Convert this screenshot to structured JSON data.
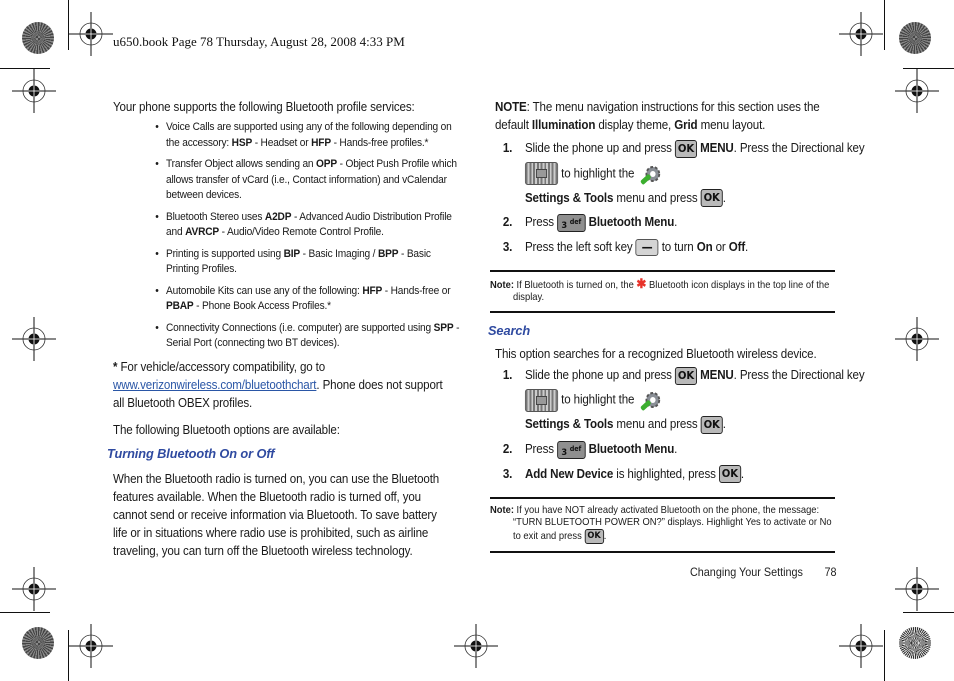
{
  "slug": "u650.book  Page 78  Thursday, August 28, 2008  4:33 PM",
  "left": {
    "intro": "Your phone supports the following Bluetooth profile services:",
    "bullets": [
      {
        "a": "Voice Calls are supported using any of the following depending on the accessory: ",
        "b1": "HSP",
        "c": " - Headset or ",
        "b2": "HFP",
        "d": " - Hands-free profiles.*"
      },
      {
        "a": "Transfer Object allows sending an ",
        "b1": "OPP",
        "c": " - Object Push Profile which allows transfer of vCard (i.e., Contact information) and vCalendar between devices.",
        "b2": "",
        "d": ""
      },
      {
        "a": "Bluetooth Stereo uses ",
        "b1": "A2DP",
        "c": " - Advanced Audio Distribution Profile and ",
        "b2": "AVRCP",
        "d": " - Audio/Video Remote Control Profile."
      },
      {
        "a": "Printing is supported using ",
        "b1": "BIP",
        "c": " - Basic Imaging / ",
        "b2": "BPP",
        "d": " - Basic Printing Profiles."
      },
      {
        "a": "Automobile Kits can use any of the following: ",
        "b1": "HFP",
        "c": " - Hands-free or ",
        "b2": "PBAP",
        "d": " - Phone Book Access Profiles.*"
      },
      {
        "a": "Connectivity Connections (i.e. computer) are supported using ",
        "b1": "SPP",
        "c": " - Serial Port (connecting two BT devices).",
        "b2": "",
        "d": ""
      }
    ],
    "footnote_star": "*",
    "footnote_a": " For vehicle/accessory compatibility, go to",
    "footnote_link": "www.verizonwireless.com/bluetoothchart",
    "footnote_b": ". Phone does not support all Bluetooth OBEX profiles.",
    "options_intro": "The following Bluetooth options are available:",
    "section_title": "Turning Bluetooth On or Off",
    "section_body": "When the Bluetooth radio is turned on, you can use the Bluetooth features available. When the Bluetooth radio is turned off, you cannot send or receive information via Bluetooth. To save battery life or in situations where radio use is prohibited, such as airline traveling, you can turn off the Bluetooth wireless technology."
  },
  "right": {
    "note_label": "NOTE",
    "note_a": ": The menu navigation instructions for this section uses the default ",
    "note_b1": "Illumination",
    "note_c": " display theme, ",
    "note_b2": "Grid",
    "note_d": " menu layout.",
    "steps1": {
      "s1_num": "1.",
      "s1_a": "Slide the phone up and press ",
      "s1_menu": "MENU",
      "s1_b": ". Press the Directional key ",
      "s1_c": " to highlight the ",
      "s1_settings": "Settings & Tools",
      "s1_d": " menu and press ",
      "s1_e": ".",
      "s2_num": "2.",
      "s2_a": "Press ",
      "s2_b": "Bluetooth Menu",
      "s2_c": ".",
      "s3_num": "3.",
      "s3_a": "Press the left soft key ",
      "s3_b": " to turn ",
      "s3_on": "On",
      "s3_or": " or ",
      "s3_off": "Off",
      "s3_c": "."
    },
    "note1_label": "Note:",
    "note1_a": " If Bluetooth is turned on, the ",
    "note1_b": " Bluetooth icon displays in the top line of the display.",
    "search_title": "Search",
    "search_intro": "This option searches for a recognized Bluetooth wireless device.",
    "steps2": {
      "s1_num": "1.",
      "s1_a": "Slide the phone up and press ",
      "s1_menu": "MENU",
      "s1_b": ". Press the Directional key ",
      "s1_c": " to highlight the ",
      "s1_settings": "Settings & Tools",
      "s1_d": " menu and press ",
      "s1_e": ".",
      "s2_num": "2.",
      "s2_a": "Press ",
      "s2_b": "Bluetooth Menu",
      "s2_c": ".",
      "s3_num": "3.",
      "s3_b": "Add New Device",
      "s3_c": " is highlighted, press ",
      "s3_d": "."
    },
    "note2_label": "Note:",
    "note2_a": " If you have NOT already activated Bluetooth on the phone, the message: “TURN BLUETOOTH POWER ON?” displays. Highlight Yes to activate or No to exit and press ",
    "note2_b": "."
  },
  "keys": {
    "ok": "OK",
    "def_digit": "3",
    "def_letters": "def",
    "soft": "—"
  },
  "footer": {
    "section": "Changing Your Settings",
    "page": "78"
  },
  "colors": {
    "heading": "#2f4aa0",
    "link": "#2a56a6",
    "bluetooth_icon": "#e8322a",
    "tools_green": "#3cae2f"
  }
}
